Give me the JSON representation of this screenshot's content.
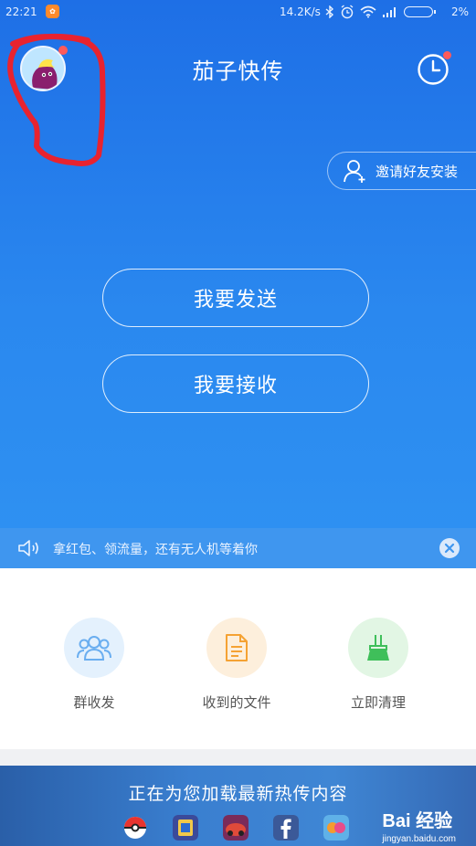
{
  "status_bar": {
    "time": "22:21",
    "net_speed": "14.2K/s",
    "battery": "2%"
  },
  "header": {
    "title": "茄子快传",
    "invite_label": "邀请好友安装"
  },
  "actions": {
    "send_label": "我要发送",
    "receive_label": "我要接收"
  },
  "notice": {
    "text": "拿红包、领流量，还有无人机等着你"
  },
  "tools": [
    {
      "label": "群收发",
      "icon": "group-icon"
    },
    {
      "label": "收到的文件",
      "icon": "document-icon"
    },
    {
      "label": "立即清理",
      "icon": "broom-icon"
    }
  ],
  "banner": {
    "text": "正在为您加载最新热传内容",
    "apps": [
      "pokeball-icon",
      "game-icon",
      "car-icon",
      "facebook-icon",
      "candy-icon"
    ]
  },
  "watermark": {
    "main": "Bai 经验",
    "sub": "jingyan.baidu.com"
  },
  "colors": {
    "primary": "#2a84ee",
    "alert_dot": "#ff5a5a",
    "annotation": "#e8232f"
  }
}
